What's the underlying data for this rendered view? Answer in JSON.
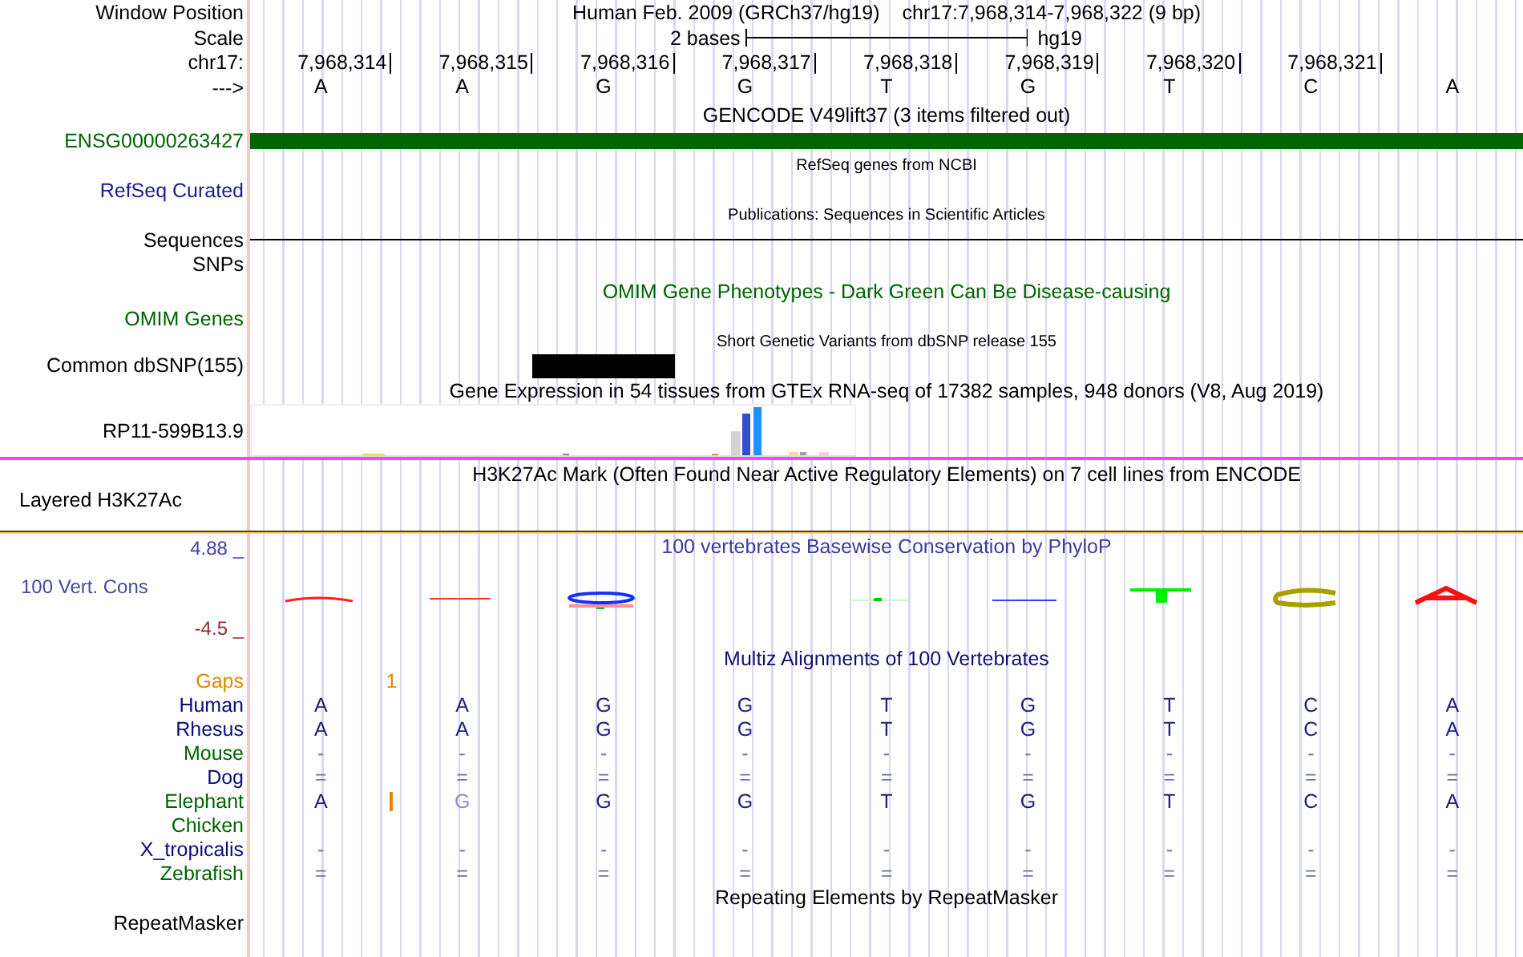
{
  "window_position": {
    "label": "Window Position",
    "assembly": "Human Feb. 2009 (GRCh37/hg19)",
    "position": "chr17:7,968,314-7,968,322 (9 bp)"
  },
  "scale": {
    "label": "Scale",
    "text": "2 bases",
    "db": "hg19"
  },
  "ruler": {
    "label": "chr17:",
    "ticks": [
      "7,968,314",
      "7,968,315",
      "7,968,316",
      "7,968,317",
      "7,968,318",
      "7,968,319",
      "7,968,320",
      "7,968,321"
    ]
  },
  "sequence": {
    "label": "--->",
    "bases": [
      "A",
      "A",
      "G",
      "G",
      "T",
      "G",
      "T",
      "C",
      "A"
    ]
  },
  "tracks": [
    {
      "kind": "gene",
      "title": "GENCODE V49lift37 (3 items filtered out)",
      "label": "ENSG00000263427",
      "color": "#006400"
    },
    {
      "kind": "refseq",
      "title": "RefSeq genes from NCBI",
      "label": "RefSeq Curated",
      "color": "#1c1c8c"
    },
    {
      "kind": "publications",
      "title": "Publications: Sequences in Scientific Articles",
      "labels": [
        "Sequences",
        "SNPs"
      ]
    },
    {
      "kind": "omim",
      "title": "OMIM Gene Phenotypes - Dark Green Can Be Disease-causing",
      "label": "OMIM Genes",
      "color": "#006400"
    },
    {
      "kind": "dbsnp",
      "title": "Short Genetic Variants from dbSNP release 155",
      "label": "Common dbSNP(155)"
    },
    {
      "kind": "expression",
      "title": "Gene Expression in 54 tissues from GTEx RNA-seq of 17382 samples, 948 donors (V8, Aug 2019)",
      "label": "RP11-599B13.9"
    },
    {
      "kind": "signal",
      "title": "H3K27Ac Mark (Often Found Near Active Regulatory Elements) on 7 cell lines from ENCODE",
      "label": "Layered H3K27Ac"
    },
    {
      "kind": "conservation",
      "title": "100 vertebrates Basewise Conservation by PhyloP",
      "label": "100 Vert. Cons",
      "max": "4.88 _",
      "min": "-4.5 _"
    },
    {
      "kind": "multiz",
      "title": "Multiz Alignments of 100 Vertebrates",
      "gaps": {
        "label": "Gaps",
        "count": "1"
      },
      "species": [
        {
          "name": "Human",
          "color": "#0c0c78",
          "bases": [
            "A",
            "A",
            "G",
            "G",
            "T",
            "G",
            "T",
            "C",
            "A"
          ]
        },
        {
          "name": "Rhesus",
          "color": "#0c0c78",
          "bases": [
            "A",
            "A",
            "G",
            "G",
            "T",
            "G",
            "T",
            "C",
            "A"
          ]
        },
        {
          "name": "Mouse",
          "color": "#006400",
          "bases": [
            "-",
            "-",
            "-",
            "-",
            "-",
            "-",
            "-",
            "-",
            "-"
          ]
        },
        {
          "name": "Dog",
          "color": "#0c0c78",
          "bases": [
            "=",
            "=",
            "=",
            "=",
            "=",
            "=",
            "=",
            "=",
            "="
          ]
        },
        {
          "name": "Elephant",
          "color": "#006400",
          "gap": true,
          "bases": [
            "A",
            "G",
            "G",
            "G",
            "T",
            "G",
            "T",
            "C",
            "A"
          ],
          "faint": [
            false,
            true,
            false,
            false,
            false,
            false,
            false,
            false,
            false
          ]
        },
        {
          "name": "Chicken",
          "color": "#006400"
        },
        {
          "name": "X_tropicalis",
          "color": "#0c0c78",
          "bases": [
            "-",
            "-",
            "-",
            "-",
            "-",
            "-",
            "-",
            "-",
            "-"
          ]
        },
        {
          "name": "Zebrafish",
          "color": "#006400",
          "bases": [
            "=",
            "=",
            "=",
            "=",
            "=",
            "=",
            "=",
            "=",
            "="
          ]
        }
      ]
    },
    {
      "kind": "repeats",
      "title": "Repeating Elements by RepeatMasker",
      "label": "RepeatMasker"
    }
  ]
}
